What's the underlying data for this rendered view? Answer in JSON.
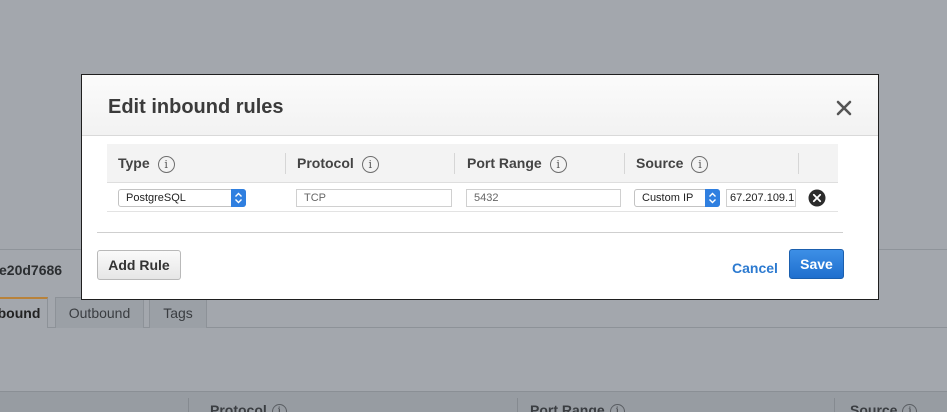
{
  "background": {
    "group_id_fragment": "e20d7686",
    "tabs": [
      {
        "label": "bound",
        "active": true
      },
      {
        "label": "Outbound",
        "active": false
      },
      {
        "label": "Tags",
        "active": false
      }
    ],
    "table_headers": [
      "Protocol",
      "Port Range",
      "Source"
    ],
    "info_glyph": "i"
  },
  "modal": {
    "title": "Edit inbound rules",
    "close_icon": "close-icon",
    "columns": [
      {
        "label": "Type",
        "info": "i"
      },
      {
        "label": "Protocol",
        "info": "i"
      },
      {
        "label": "Port Range",
        "info": "i"
      },
      {
        "label": "Source",
        "info": "i"
      }
    ],
    "rule": {
      "type": "PostgreSQL",
      "protocol": "TCP",
      "port_range": "5432",
      "source_type": "Custom IP",
      "source_value": "67.207.109.1"
    },
    "add_rule_label": "Add Rule",
    "cancel_label": "Cancel",
    "save_label": "Save"
  },
  "colors": {
    "accent": "#2f7fe0",
    "save_button": "#1f6fce",
    "link": "#2c7ad0",
    "overlay": "#a3a7ad"
  }
}
